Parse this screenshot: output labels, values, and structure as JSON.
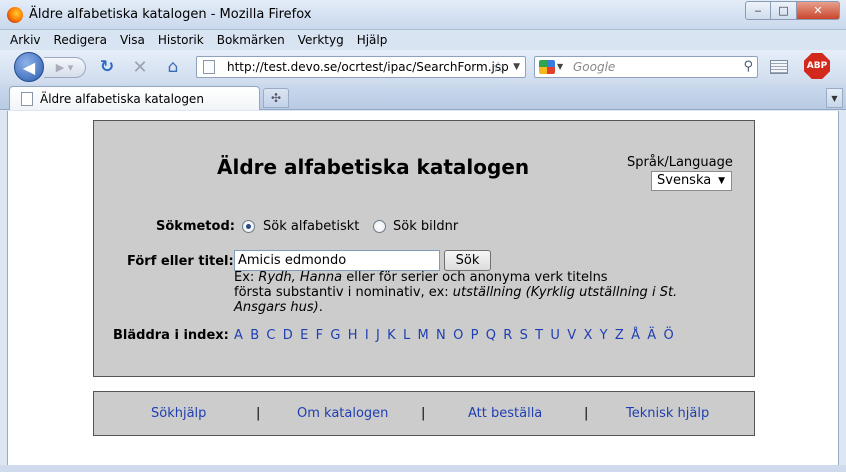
{
  "window": {
    "title": "Äldre alfabetiska katalogen - Mozilla Firefox",
    "controls": {
      "minimize": "‒",
      "maximize": "□",
      "close": "✕"
    }
  },
  "menu": [
    "Arkiv",
    "Redigera",
    "Visa",
    "Historik",
    "Bokmärken",
    "Verktyg",
    "Hjälp"
  ],
  "nav": {
    "url": "http://test.devo.se/ocrtest/ipac/SearchForm.jsp",
    "search_placeholder": "Google",
    "abp_label": "ABP"
  },
  "tab": {
    "label": "Äldre alfabetiska katalogen"
  },
  "page": {
    "title": "Äldre alfabetiska katalogen",
    "language_label": "Språk/Language",
    "language_value": "Svenska",
    "search_method_label": "Sökmetod:",
    "radio_alpha": "Sök alfabetiskt",
    "radio_image": "Sök bildnr",
    "author_title_label": "Förf eller titel:",
    "search_value": "Amicis edmondo",
    "search_button": "Sök",
    "help_line1_prefix": "Ex: ",
    "help_line1_em": "Rydh, Hanna",
    "help_line1_rest": " eller för serier och anonyma verk titelns",
    "help_line2_prefix": "första substantiv i nominativ, ex: ",
    "help_line2_em": "utställning (Kyrklig utställning i St. Ansgars hus)",
    "help_line2_end": ".",
    "browse_label": "Bläddra i index:",
    "letters": [
      "A",
      "B",
      "C",
      "D",
      "E",
      "F",
      "G",
      "H",
      "I",
      "J",
      "K",
      "L",
      "M",
      "N",
      "O",
      "P",
      "Q",
      "R",
      "S",
      "T",
      "U",
      "V",
      "X",
      "Y",
      "Z",
      "Å",
      "Ä",
      "Ö"
    ]
  },
  "footer": {
    "links": [
      "Sökhjälp",
      "Om katalogen",
      "Att beställa",
      "Teknisk hjälp"
    ],
    "separator": "|"
  },
  "colors": {
    "link": "#1f3fb0",
    "panel": "#cccccc"
  }
}
